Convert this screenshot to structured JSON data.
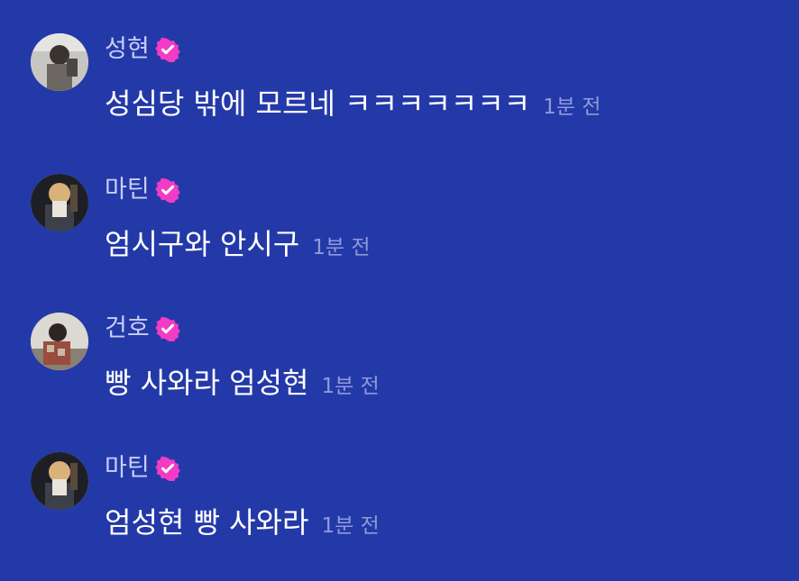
{
  "colors": {
    "background": "#2439a8",
    "username": "#c9cdf6",
    "message": "#ffffff",
    "timestamp": "#8f9ad8",
    "verified_badge": "#f23cc5"
  },
  "messages": [
    {
      "username": "성현",
      "verified": true,
      "text": "성심당 밖에 모르네 ㅋㅋㅋㅋㅋㅋㅋ",
      "time": "1분 전"
    },
    {
      "username": "마틴",
      "verified": true,
      "text": "엄시구와 안시구",
      "time": "1분 전"
    },
    {
      "username": "건호",
      "verified": true,
      "text": "빵 사와라 엄성현",
      "time": "1분 전"
    },
    {
      "username": "마틴",
      "verified": true,
      "text": "엄성현 빵 사와라",
      "time": "1분 전"
    }
  ]
}
